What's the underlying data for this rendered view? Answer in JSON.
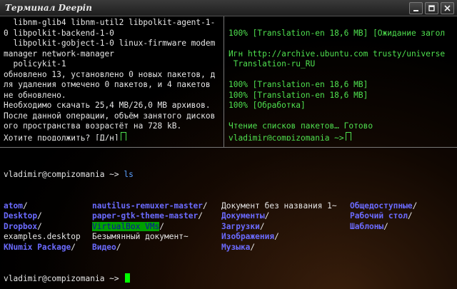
{
  "window": {
    "title": "Терминал Deepin",
    "buttons": [
      "minimize",
      "maximize",
      "close"
    ]
  },
  "left_pane": {
    "lines": [
      "  libnm-glib4 libnm-util2 libpolkit-agent-1-",
      "0 libpolkit-backend-1-0",
      "  libpolkit-gobject-1-0 linux-firmware modem",
      "manager network-manager",
      "  policykit-1",
      "обновлено 13, установлено 0 новых пакетов, д",
      "ля удаления отмечено 0 пакетов, и 4 пакетов",
      "не обновлено.",
      "Необходимо скачать 25,4 МВ/26,0 МВ архивов.",
      "После данной операции, объём занятого дисков",
      "ого пространства возрастёт на 728 kB.",
      "Хотите продолжить? [Д/н]"
    ]
  },
  "right_pane": {
    "lines": [
      "",
      "100% [Translation-en 18,6 MB] [Ожидание загол",
      "",
      "Игн http://archive.ubuntu.com trusty/universe",
      " Translation-ru_RU",
      "",
      "100% [Translation-en 18,6 MB]",
      "100% [Translation-en 18,6 MB]",
      "100% [Обработка]",
      "",
      "Чтение списков пакетов… Готово",
      "vladimir@compizomania ~>"
    ]
  },
  "bottom_pane": {
    "prompt": "vladimir@compizomania ~>",
    "command": "ls",
    "final_prompt": "vladimir@compizomania ~>",
    "ls_rows": [
      [
        {
          "name": "atom",
          "type": "dir"
        },
        {
          "name": "nautilus-remuxer-master",
          "type": "dir"
        },
        {
          "name": "Документ без названия 1~",
          "type": "file"
        },
        {
          "name": "Общедоступные",
          "type": "dir"
        }
      ],
      [
        {
          "name": "Desktop",
          "type": "dir"
        },
        {
          "name": "paper-gtk-theme-master",
          "type": "dir"
        },
        {
          "name": "Документы",
          "type": "dir"
        },
        {
          "name": "Рабочий стол",
          "type": "dir"
        }
      ],
      [
        {
          "name": "Dropbox",
          "type": "dir"
        },
        {
          "name": "VirtualBox VMs",
          "type": "dir-highlight"
        },
        {
          "name": "Загрузки",
          "type": "dir"
        },
        {
          "name": "Шаблоны",
          "type": "dir"
        }
      ],
      [
        {
          "name": "examples.desktop",
          "type": "file"
        },
        {
          "name": "Безымянный документ~",
          "type": "file"
        },
        {
          "name": "Изображения",
          "type": "dir"
        },
        {
          "name": "",
          "type": "empty"
        }
      ],
      [
        {
          "name": "KNumix Package",
          "type": "dir"
        },
        {
          "name": "Видео",
          "type": "dir"
        },
        {
          "name": "Музыка",
          "type": "dir"
        },
        {
          "name": "",
          "type": "empty"
        }
      ]
    ]
  },
  "colors": {
    "dir": "#6b6bff",
    "prompt_output": "#4fe04f",
    "cursor": "#00ff00",
    "highlight_bg": "#00a000"
  }
}
